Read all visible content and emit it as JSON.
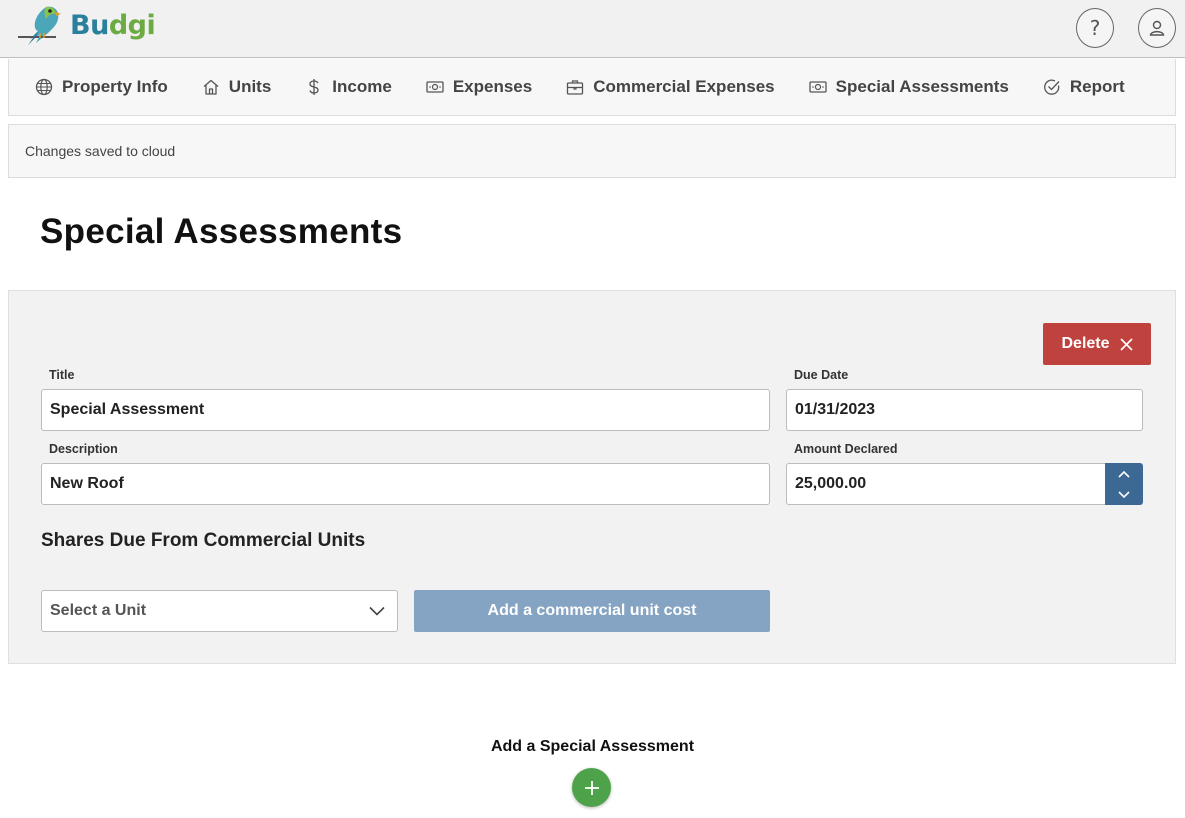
{
  "app": {
    "brand": "Budgi",
    "brand_part1": "Bu",
    "brand_part2": "dgi"
  },
  "header": {
    "help_icon": "question-icon",
    "user_icon": "user-icon"
  },
  "tabs": [
    {
      "label": "Property Info",
      "icon": "globe-icon"
    },
    {
      "label": "Units",
      "icon": "home-icon"
    },
    {
      "label": "Income",
      "icon": "dollar-icon"
    },
    {
      "label": "Expenses",
      "icon": "cash-icon"
    },
    {
      "label": "Commercial Expenses",
      "icon": "briefcase-icon"
    },
    {
      "label": "Special Assessments",
      "icon": "cash-icon"
    },
    {
      "label": "Report",
      "icon": "check-circle-icon"
    }
  ],
  "status": {
    "text": "Changes saved to cloud"
  },
  "page": {
    "title": "Special Assessments"
  },
  "assessment": {
    "delete_label": "Delete",
    "title_label": "Title",
    "title_value": "Special Assessment",
    "due_date_label": "Due Date",
    "due_date_value": "01/31/2023",
    "description_label": "Description",
    "description_value": "New Roof",
    "amount_label": "Amount Declared",
    "amount_value": "25,000.00",
    "shares_title": "Shares Due From Commercial Units",
    "unit_select": "Select a Unit",
    "add_unit_cost_label": "Add a commercial unit cost"
  },
  "footer": {
    "add_label": "Add a Special Assessment"
  },
  "colors": {
    "delete": "#c0423f",
    "stepper": "#3c6894",
    "add_cost": "#85a3c2",
    "add": "#4ea24a",
    "brand_blue": "#2a7f9c",
    "brand_green": "#6bab42"
  }
}
